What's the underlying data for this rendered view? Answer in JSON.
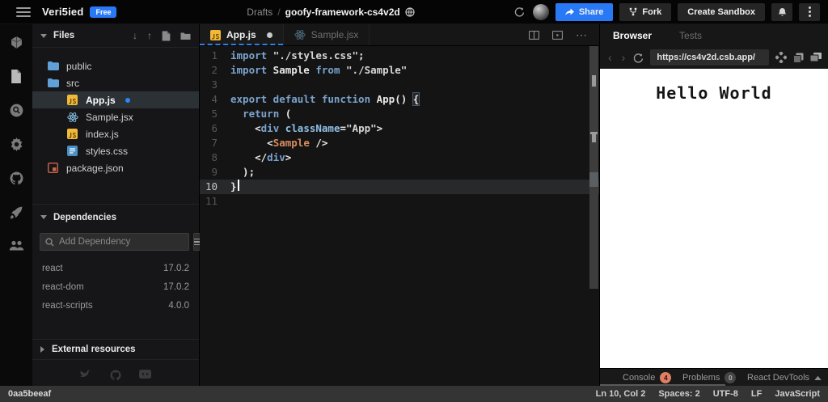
{
  "topbar": {
    "brand": "Veri5ied",
    "plan_badge": "Free",
    "breadcrumb": {
      "parent": "Drafts",
      "separator": "/",
      "title": "goofy-framework-cs4v2d"
    },
    "buttons": {
      "share": "Share",
      "fork": "Fork",
      "create_sandbox": "Create Sandbox"
    }
  },
  "sidebar": {
    "files": {
      "title": "Files",
      "items": [
        {
          "label": "public",
          "icon": "folder",
          "depth": 0,
          "selected": false,
          "modified": false
        },
        {
          "label": "src",
          "icon": "folder",
          "depth": 0,
          "selected": false,
          "modified": false
        },
        {
          "label": "App.js",
          "icon": "js",
          "depth": 1,
          "selected": true,
          "modified": true
        },
        {
          "label": "Sample.jsx",
          "icon": "react",
          "depth": 1,
          "selected": false,
          "modified": false
        },
        {
          "label": "index.js",
          "icon": "js",
          "depth": 1,
          "selected": false,
          "modified": false
        },
        {
          "label": "styles.css",
          "icon": "css",
          "depth": 1,
          "selected": false,
          "modified": false
        },
        {
          "label": "package.json",
          "icon": "json",
          "depth": 0,
          "selected": false,
          "modified": false
        }
      ]
    },
    "dependencies": {
      "title": "Dependencies",
      "add_placeholder": "Add Dependency",
      "items": [
        {
          "name": "react",
          "version": "17.0.2"
        },
        {
          "name": "react-dom",
          "version": "17.0.2"
        },
        {
          "name": "react-scripts",
          "version": "4.0.0"
        }
      ]
    },
    "external_resources": {
      "title": "External resources"
    }
  },
  "editor": {
    "tabs": [
      {
        "label": "App.js",
        "icon": "js",
        "active": true,
        "modified": true
      },
      {
        "label": "Sample.jsx",
        "icon": "react",
        "active": false,
        "modified": false
      }
    ],
    "code_lines": [
      {
        "n": "1",
        "tokens": [
          [
            "k",
            "import"
          ],
          [
            "p",
            " "
          ],
          [
            "s",
            "\"./styles.css\""
          ],
          [
            "p",
            ";"
          ]
        ]
      },
      {
        "n": "2",
        "tokens": [
          [
            "k",
            "import"
          ],
          [
            "p",
            " Sample "
          ],
          [
            "k",
            "from"
          ],
          [
            "p",
            " "
          ],
          [
            "s",
            "\"./Sample\""
          ]
        ]
      },
      {
        "n": "3",
        "tokens": []
      },
      {
        "n": "4",
        "tokens": [
          [
            "k",
            "export default function"
          ],
          [
            "p",
            " App() "
          ],
          [
            "b",
            "{"
          ]
        ]
      },
      {
        "n": "5",
        "tokens": [
          [
            "p",
            "  "
          ],
          [
            "k",
            "return"
          ],
          [
            "p",
            " ("
          ]
        ]
      },
      {
        "n": "6",
        "tokens": [
          [
            "p",
            "    <"
          ],
          [
            "t",
            "div"
          ],
          [
            "p",
            " "
          ],
          [
            "a",
            "className"
          ],
          [
            "p",
            "="
          ],
          [
            "s",
            "\"App\""
          ],
          [
            "p",
            ">"
          ]
        ]
      },
      {
        "n": "7",
        "tokens": [
          [
            "p",
            "      <"
          ],
          [
            "c",
            "Sample"
          ],
          [
            "p",
            " />"
          ]
        ]
      },
      {
        "n": "8",
        "tokens": [
          [
            "p",
            "    </"
          ],
          [
            "t",
            "div"
          ],
          [
            "p",
            ">"
          ]
        ]
      },
      {
        "n": "9",
        "tokens": [
          [
            "p",
            "  );"
          ]
        ]
      },
      {
        "n": "10",
        "tokens": [
          [
            "p",
            "}"
          ]
        ],
        "current": true
      },
      {
        "n": "11",
        "tokens": []
      }
    ]
  },
  "preview": {
    "tabs": {
      "browser": "Browser",
      "tests": "Tests"
    },
    "url": "https://cs4v2d.csb.app/",
    "viewport_text": "Hello World",
    "console_bar": {
      "console": "Console",
      "console_count": "4",
      "problems": "Problems",
      "problems_count": "0",
      "devtools": "React DevTools"
    }
  },
  "statusbar": {
    "left": "0aa5beeaf",
    "items": [
      "Ln 10, Col 2",
      "Spaces: 2",
      "UTF-8",
      "LF",
      "JavaScript"
    ]
  },
  "colors": {
    "accent": "#2979F7",
    "console_badge": "#DF7E62",
    "keyword": "#7aa3cd",
    "component": "#d98c5f"
  }
}
